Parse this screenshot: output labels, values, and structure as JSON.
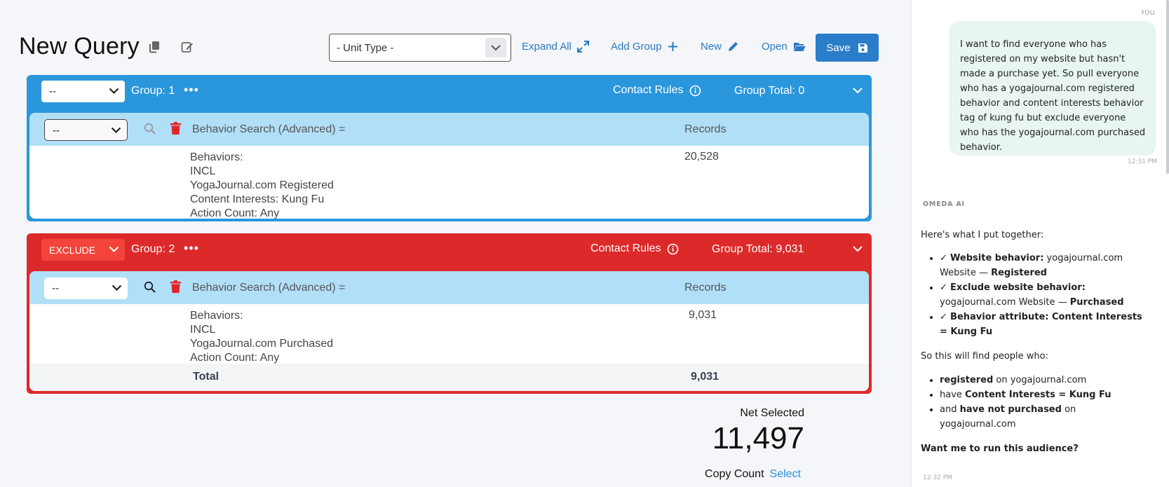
{
  "header": {
    "title": "New Query",
    "unit_type": "- Unit Type -",
    "expand_all": "Expand All",
    "add_group": "Add Group",
    "new": "New",
    "open": "Open",
    "save": "Save"
  },
  "groups": [
    {
      "select": "--",
      "label": "Group: 1",
      "contact_rules": "Contact Rules",
      "total": "Group Total: 0",
      "row": {
        "select": "--",
        "title": "Behavior Search (Advanced) =",
        "records_label": "Records",
        "details": [
          "Behaviors:",
          "INCL",
          "YogaJournal.com Registered",
          "Content Interests: Kung Fu",
          "Action Count: Any"
        ],
        "records_value": "20,528"
      }
    },
    {
      "select": "EXCLUDE",
      "label": "Group: 2",
      "contact_rules": "Contact Rules",
      "total": "Group Total: 9,031",
      "row": {
        "select": "--",
        "title": "Behavior Search (Advanced) =",
        "records_label": "Records",
        "details": [
          "Behaviors:",
          "INCL",
          "YogaJournal.com Purchased",
          "Action Count: Any"
        ],
        "records_value": "9,031"
      },
      "total_row": {
        "label": "Total",
        "value": "9,031"
      }
    }
  ],
  "net": {
    "label": "Net Selected",
    "value": "11,497",
    "copy_count": "Copy Count",
    "select": "Select"
  },
  "chat": {
    "you_label": "YOU",
    "user_message": "I want to find everyone who has registered on my website but hasn't made a purchase yet. So pull everyone who has a yogajournal.com registered behavior and content interests behavior tag of kung fu but exclude everyone who has the yogajournal.com purchased behavior.",
    "user_time": "12:31 PM",
    "ai_label": "OMEDA AI",
    "ai_intro": "Here's what I put together:",
    "bullets": [
      {
        "check": "✓",
        "bold": "Website behavior:",
        "rest1": " yogajournal.com Website — ",
        "bold2": "Registered"
      },
      {
        "check": "✓",
        "bold": "Exclude website behavior:",
        "rest1": " yogajournal.com Website — ",
        "bold2": "Purchased"
      },
      {
        "check": "✓",
        "bold": "Behavior attribute: Content Interests = Kung Fu",
        "rest1": "",
        "bold2": ""
      }
    ],
    "ai_middle": "So this will find people who:",
    "finds": [
      {
        "pre": "",
        "bold": "registered",
        "post": " on yogajournal.com"
      },
      {
        "pre": "have ",
        "bold": "Content Interests = Kung Fu",
        "post": ""
      },
      {
        "pre": "and ",
        "bold": "have not purchased",
        "post": " on yogajournal.com"
      }
    ],
    "ai_question": "Want me to run this audience?",
    "ai_time": "12:32 PM"
  },
  "colors": {
    "blue_group": "#2a96dc",
    "red_group": "#dc2a2a",
    "row_header": "#b2dff8",
    "accent": "#2a7dc8"
  }
}
